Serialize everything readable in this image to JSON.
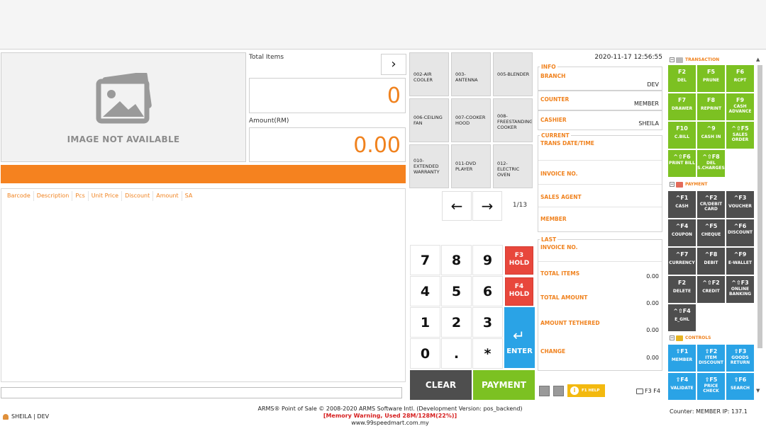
{
  "product": {
    "image_placeholder": "IMAGE NOT AVAILABLE"
  },
  "totals": {
    "total_items_label": "Total Items",
    "total_items_value": "0",
    "amount_label": "Amount(RM)",
    "amount_value": "0.00",
    "next_arrow": "›"
  },
  "grid": {
    "columns": [
      "Barcode",
      "Description",
      "Pcs",
      "Unit Price",
      "Discount",
      "Amount",
      "SA"
    ]
  },
  "categories": {
    "items": [
      "002-AIR COOLER",
      "003-ANTENNA",
      "005-BLENDER",
      "006-CEILING FAN",
      "007-COOKER HOOD",
      "008-FREESTANDING COOKER",
      "010-EXTENDED WARRANTY",
      "011-DVD PLAYER",
      "012-ELECTRIC OVEN"
    ],
    "prev": "←",
    "next": "→",
    "page": "1/13"
  },
  "keypad": {
    "keys": [
      "7",
      "8",
      "9",
      "4",
      "5",
      "6",
      "1",
      "2",
      "3",
      "0",
      ".",
      "*"
    ],
    "hold1_key": "F3",
    "hold1_label": "HOLD",
    "hold2_key": "F4",
    "hold2_label": "HOLD",
    "enter_symbol": "↵",
    "enter_label": "ENTER",
    "clear_label": "CLEAR",
    "payment_label": "PAYMENT"
  },
  "info": {
    "datetime": "2020-11-17 12:56:55",
    "info_legend": "INFO",
    "branch_label": "BRANCH",
    "branch_value": "DEV",
    "counter_label": "COUNTER",
    "counter_value": "MEMBER",
    "cashier_label": "CASHIER",
    "cashier_value": "SHEILA",
    "current_legend": "CURRENT",
    "trans_label": "TRANS DATE/TIME",
    "invoice_label": "INVOICE NO.",
    "sales_agent_label": "SALES AGENT",
    "member_label": "MEMBER",
    "last_legend": "LAST",
    "last_invoice_label": "INVOICE NO.",
    "total_items_label": "TOTAL ITEMS",
    "total_items_value": "0.00",
    "total_amount_label": "TOTAL AMOUNT",
    "total_amount_value": "0.00",
    "tethered_label": "AMOUNT TETHERED",
    "tethered_value": "0.00",
    "change_label": "CHANGE",
    "change_value": "0.00"
  },
  "sections": {
    "transaction": "TRANSACTION",
    "payment": "PAYMENT",
    "controls": "CONTROLS",
    "collapse": "−"
  },
  "transaction_keys": [
    {
      "key": "F2",
      "label": "DEL"
    },
    {
      "key": "F5",
      "label": "PRUNE"
    },
    {
      "key": "F6",
      "label": "RCPT"
    },
    {
      "key": "F7",
      "label": "DRAWER"
    },
    {
      "key": "F8",
      "label": "REPRINT"
    },
    {
      "key": "F9",
      "label": "CASH ADVANCE"
    },
    {
      "key": "F10",
      "label": "C.BILL"
    },
    {
      "key": "^9",
      "label": "CASH IN"
    },
    {
      "key": "^⇧F5",
      "label": "SALES ORDER"
    },
    {
      "key": "^⇧F6",
      "label": "PRINT BILL"
    },
    {
      "key": "^⇧F8",
      "label": "DEL S.CHARGES"
    }
  ],
  "payment_keys": [
    {
      "key": "^F1",
      "label": "CASH"
    },
    {
      "key": "^F2",
      "label": "CR/DEBIT CARD"
    },
    {
      "key": "^F3",
      "label": "VOUCHER"
    },
    {
      "key": "^F4",
      "label": "COUPON"
    },
    {
      "key": "^F5",
      "label": "CHEQUE"
    },
    {
      "key": "^F6",
      "label": "DISCOUNT"
    },
    {
      "key": "^F7",
      "label": "CURRENCY"
    },
    {
      "key": "^F8",
      "label": "DEBIT"
    },
    {
      "key": "^F9",
      "label": "E-WALLET"
    },
    {
      "key": "F2",
      "label": "DELETE"
    },
    {
      "key": "^⇧F2",
      "label": "CREDIT"
    },
    {
      "key": "^⇧F3",
      "label": "ONLINE BANKING"
    },
    {
      "key": "^⇧F4",
      "label": "E_GHL"
    }
  ],
  "control_keys": [
    {
      "key": "⇧F1",
      "label": "MEMBER"
    },
    {
      "key": "⇧F2",
      "label": "ITEM DISCOUNT"
    },
    {
      "key": "⇧F3",
      "label": "GOODS RETURN"
    },
    {
      "key": "⇧F4",
      "label": "VALIDATE"
    },
    {
      "key": "⇧F5",
      "label": "PRICE CHECK"
    },
    {
      "key": "⇧F6",
      "label": "SEARCH"
    }
  ],
  "help": {
    "label": "F1 HELP",
    "icon": "i"
  },
  "f3f4": "F3 F4",
  "footer": {
    "user": "SHEILA | DEV",
    "copyright": "ARMS® Point of Sale © 2008-2020 ARMS Software Intl. (Development Version: pos_backend)",
    "memory_warning": "[Memory Warning, Used 28M/128M(22%)]",
    "website": "www.99speedmart.com.my",
    "counter_info": "Counter: MEMBER   IP: 137.1"
  },
  "colors": {
    "accent_orange": "#f5821f",
    "green": "#7cc122",
    "dark": "#4e4e4e",
    "blue": "#2aa3e6",
    "red": "#e8473c"
  }
}
